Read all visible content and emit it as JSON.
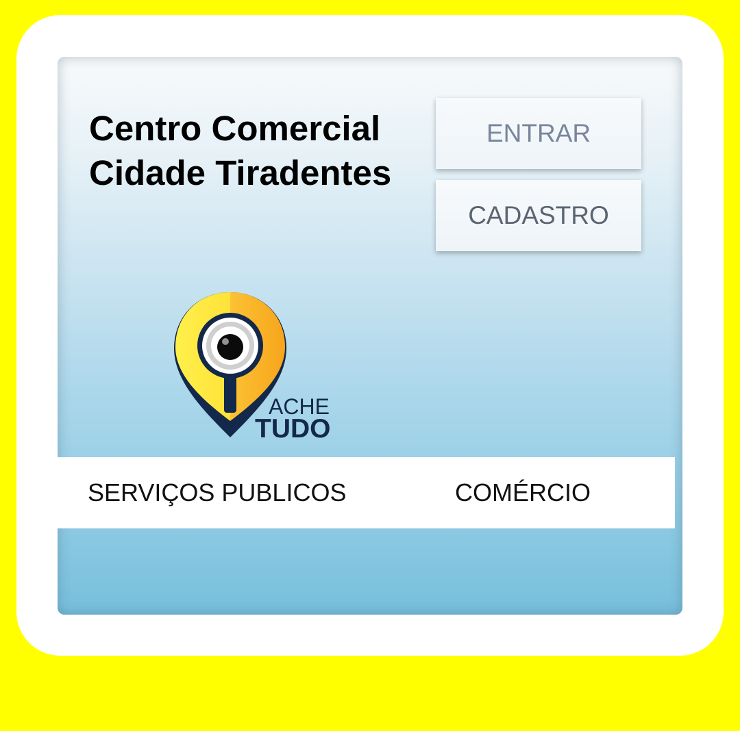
{
  "header": {
    "title_line1": "Centro Comercial",
    "title_line2": "Cidade Tiradentes"
  },
  "auth": {
    "login_label": "ENTRAR",
    "signup_label": "CADASTRO"
  },
  "logo": {
    "line1": "ACHE",
    "line2": "TUDO"
  },
  "tabs": [
    {
      "label": "SERVIÇOS PUBLICOS"
    },
    {
      "label": "COMÉRCIO"
    }
  ],
  "colors": {
    "background": "#ffff00",
    "frame": "#ffffff",
    "logo_navy": "#13284a",
    "logo_yellow": "#ffe23a",
    "logo_orange": "#f7a51c"
  }
}
